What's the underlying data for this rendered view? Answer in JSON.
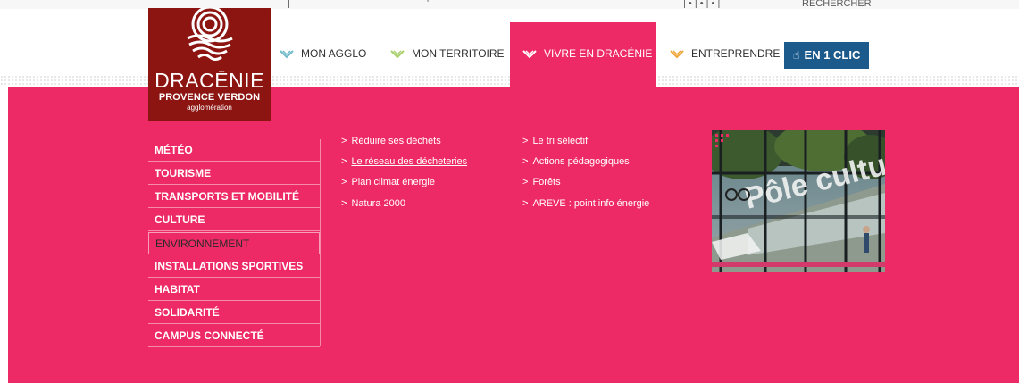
{
  "colors": {
    "pink": "#ee2a66",
    "logo_bg": "#8c1512",
    "button_bg": "#1c5a8c",
    "nav_text": "#2f2f2f",
    "chevron": "#6fb9c9"
  },
  "top_strip": {
    "right_text": "RECHERCHER"
  },
  "logo": {
    "line1": "DRACĒNIE",
    "line2": "PROVENCE VERDON",
    "line3": "agglomération"
  },
  "nav": {
    "items": [
      {
        "label": "MON AGGLO",
        "icon": "chevron-down-icon"
      },
      {
        "label": "MON TERRITOIRE",
        "icon": "chevron-down-icon"
      },
      {
        "label": "VIVRE EN DRACÉNIE",
        "icon": "chevron-down-icon",
        "active": true
      },
      {
        "label": "ENTREPRENDRE",
        "icon": "chevron-down-icon"
      }
    ],
    "cta": {
      "label": "EN 1 CLIC",
      "icon": "hand-pointer-icon"
    }
  },
  "sidebar": {
    "items": [
      {
        "label": "MÉTÉO"
      },
      {
        "label": "TOURISME"
      },
      {
        "label": "TRANSPORTS ET MOBILITÉ"
      },
      {
        "label": "CULTURE"
      },
      {
        "label": "ENVIRONNEMENT",
        "active": true
      },
      {
        "label": "INSTALLATIONS SPORTIVES"
      },
      {
        "label": "HABITAT"
      },
      {
        "label": "SOLIDARITÉ"
      },
      {
        "label": "CAMPUS CONNECTÉ"
      }
    ]
  },
  "submenu": {
    "col1": [
      "Réduire ses déchets",
      "Le réseau des décheteries",
      "Plan climat énergie",
      "Natura 2000"
    ],
    "col2": [
      "Le tri sélectif",
      "Actions pédagogiques",
      "Forêts",
      "AREVE : point info énergie"
    ],
    "arrow": ">"
  },
  "photo": {
    "caption_text": "Pôle culturel"
  }
}
